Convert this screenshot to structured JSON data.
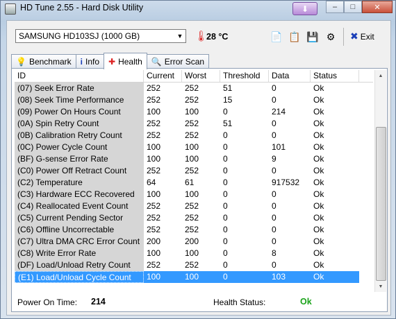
{
  "window": {
    "title": "HD Tune 2.55 - Hard Disk Utility"
  },
  "toolbar": {
    "drive": "SAMSUNG HD103SJ (1000 GB)",
    "temperature": "28 °C",
    "exit_label": "Exit"
  },
  "tabs": [
    {
      "label": "Benchmark"
    },
    {
      "label": "Info"
    },
    {
      "label": "Health"
    },
    {
      "label": "Error Scan"
    }
  ],
  "table": {
    "headers": [
      "ID",
      "Current",
      "Worst",
      "Threshold",
      "Data",
      "Status"
    ],
    "rows": [
      [
        "(07) Seek Error Rate",
        "252",
        "252",
        "51",
        "0",
        "Ok"
      ],
      [
        "(08) Seek Time Performance",
        "252",
        "252",
        "15",
        "0",
        "Ok"
      ],
      [
        "(09) Power On Hours Count",
        "100",
        "100",
        "0",
        "214",
        "Ok"
      ],
      [
        "(0A) Spin Retry Count",
        "252",
        "252",
        "51",
        "0",
        "Ok"
      ],
      [
        "(0B) Calibration Retry Count",
        "252",
        "252",
        "0",
        "0",
        "Ok"
      ],
      [
        "(0C) Power Cycle Count",
        "100",
        "100",
        "0",
        "101",
        "Ok"
      ],
      [
        "(BF) G-sense Error Rate",
        "100",
        "100",
        "0",
        "9",
        "Ok"
      ],
      [
        "(C0) Power Off Retract Count",
        "252",
        "252",
        "0",
        "0",
        "Ok"
      ],
      [
        "(C2) Temperature",
        "64",
        "61",
        "0",
        "917532",
        "Ok"
      ],
      [
        "(C3) Hardware ECC Recovered",
        "100",
        "100",
        "0",
        "0",
        "Ok"
      ],
      [
        "(C4) Reallocated Event Count",
        "252",
        "252",
        "0",
        "0",
        "Ok"
      ],
      [
        "(C5) Current Pending Sector",
        "252",
        "252",
        "0",
        "0",
        "Ok"
      ],
      [
        "(C6) Offline Uncorrectable",
        "252",
        "252",
        "0",
        "0",
        "Ok"
      ],
      [
        "(C7) Ultra DMA CRC Error Count",
        "200",
        "200",
        "0",
        "0",
        "Ok"
      ],
      [
        "(C8) Write Error Rate",
        "100",
        "100",
        "0",
        "8",
        "Ok"
      ],
      [
        "(DF) Load/Unload Retry Count",
        "252",
        "252",
        "0",
        "0",
        "Ok"
      ],
      [
        "(E1) Load/Unload Cycle Count",
        "100",
        "100",
        "0",
        "103",
        "Ok"
      ]
    ],
    "selected_row": 16
  },
  "footer": {
    "power_on_label": "Power On Time:",
    "power_on_value": "214",
    "health_label": "Health Status:",
    "health_value": "Ok"
  },
  "colors": {
    "selection": "#3399ff",
    "health_ok": "#1aa31a",
    "temperature_icon": "#dd2222"
  }
}
